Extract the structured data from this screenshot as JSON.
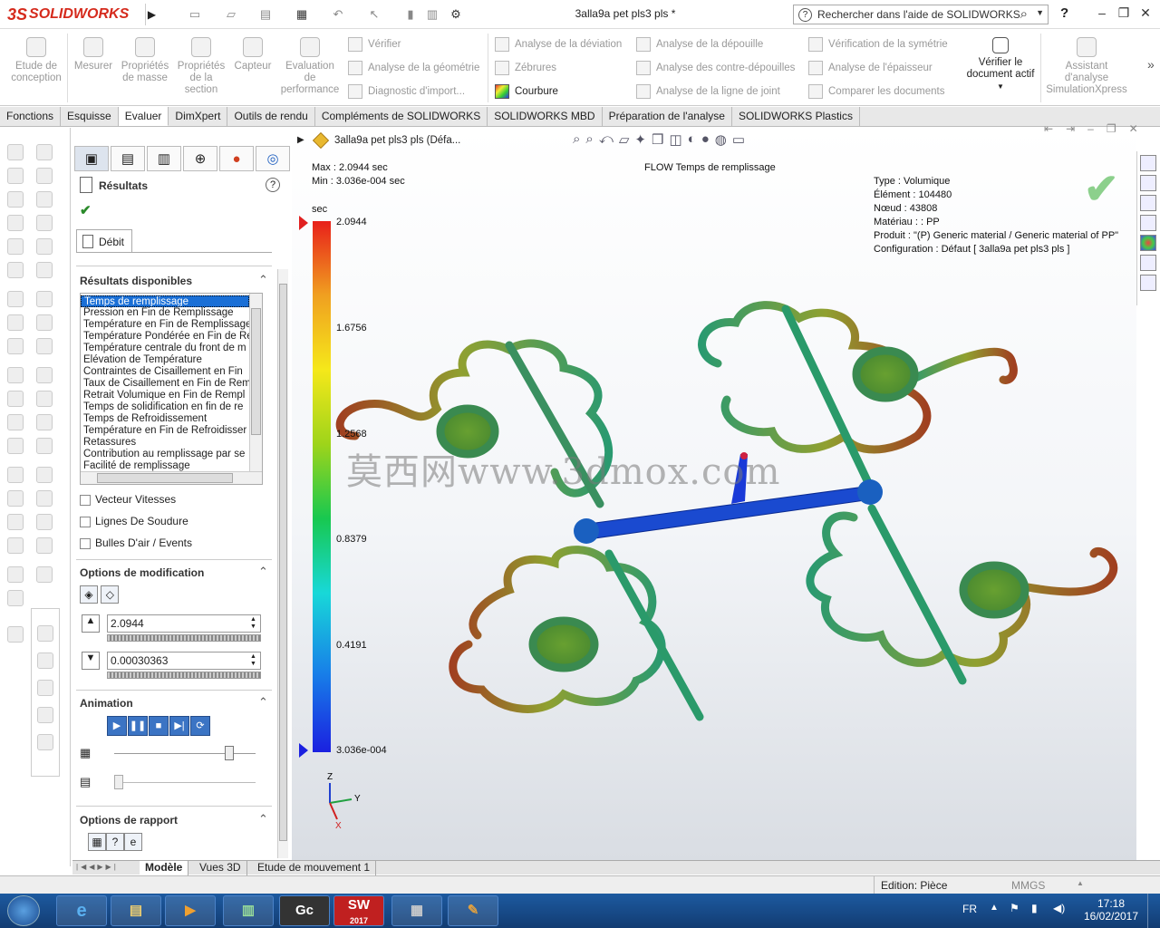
{
  "app": {
    "logo": "SOLIDWORKS",
    "logo_prefix": "3S",
    "document_title": "3alla9a pet pls3 pls *",
    "search_placeholder": "Rechercher dans l'aide de SOLIDWORKS",
    "help": "?"
  },
  "ribbon": {
    "big_buttons": [
      {
        "label": "Etude de\nconception",
        "icon": "design-study-icon"
      },
      {
        "label": "Mesurer",
        "icon": "measure-icon"
      },
      {
        "label": "Propriétés\nde masse",
        "icon": "mass-properties-icon"
      },
      {
        "label": "Propriétés\nde la\nsection",
        "icon": "section-properties-icon"
      },
      {
        "label": "Capteur",
        "icon": "sensor-icon"
      },
      {
        "label": "Evaluation\nde\nperformance",
        "icon": "performance-icon"
      }
    ],
    "col1": [
      "Vérifier",
      "Analyse de la géométrie",
      "Diagnostic d'import..."
    ],
    "col2": [
      "Analyse de la déviation",
      "Zébrures",
      "Courbure"
    ],
    "col3": [
      "Analyse de la dépouille",
      "Analyse des contre-dépouilles",
      "Analyse de la ligne de joint"
    ],
    "col4": [
      "Vérification de la symétrie",
      "Analyse de l'épaisseur",
      "Comparer les documents"
    ],
    "verify_active": "Vérifier le\ndocument actif",
    "simxpress": "Assistant\nd'analyse\nSimulationXpress"
  },
  "tabs": [
    "Fonctions",
    "Esquisse",
    "Evaluer",
    "DimXpert",
    "Outils de rendu",
    "Compléments de SOLIDWORKS",
    "SOLIDWORKS MBD",
    "Préparation de l'analyse",
    "SOLIDWORKS Plastics"
  ],
  "active_tab": "Evaluer",
  "pm": {
    "title": "Résultats",
    "subtab": "Débit",
    "results_header": "Résultats disponibles",
    "results": [
      "Temps de remplissage",
      "Pression en Fin de Remplissage",
      "Température en Fin de Remplissage",
      "Température Pondérée en Fin de Re",
      "Température centrale du front de m",
      "Élévation de Température",
      "Contraintes de Cisaillement en Fin",
      "Taux de Cisaillement en Fin de Rem",
      "Retrait Volumique en Fin de Rempl",
      "Temps de solidification en fin de re",
      "Temps de Refroidissement",
      "Température en Fin de Refroidisser",
      "Retassures",
      "Contribution au remplissage par se",
      "Facilité de remplissage"
    ],
    "checkboxes": [
      "Vecteur Vitesses",
      "Lignes De Soudure",
      "Bulles D'air / Events"
    ],
    "mod_header": "Options de modification",
    "max_value": "2.0944",
    "min_value": "0.00030363",
    "anim_header": "Animation",
    "report_header": "Options de rapport"
  },
  "viewport": {
    "tree_label": "3alla9a pet pls3 pls  (Défa...",
    "max_text": "Max : 2.0944 sec",
    "min_text": "Min : 3.036e-004 sec",
    "plot_title": "FLOW Temps de remplissage",
    "legend_unit": "sec",
    "legend_values": [
      "2.0944",
      "1.6756",
      "1.2568",
      "0.8379",
      "0.4191",
      "3.036e-004"
    ],
    "info": [
      "Type : Volumique",
      "Élément : 104480",
      "Nœud : 43808",
      "Matériau : : PP",
      "Produit :   \"(P)  Generic material / Generic material of PP\"",
      "Configuration : Défaut [ 3alla9a pet pls3 pls ]"
    ],
    "watermark": "莫西网www.3dmox.com",
    "axes": {
      "x": "X",
      "y": "Y",
      "z": "Z"
    }
  },
  "bottom_tabs": [
    "Modèle",
    "Vues 3D",
    "Etude de mouvement 1"
  ],
  "status": {
    "edition": "Edition: Pièce",
    "units": "MMGS"
  },
  "taskbar": {
    "lang": "FR",
    "time": "17:18",
    "date": "16/02/2017",
    "gc": "Gc",
    "sw": "SW",
    "sw_year": "2017"
  }
}
